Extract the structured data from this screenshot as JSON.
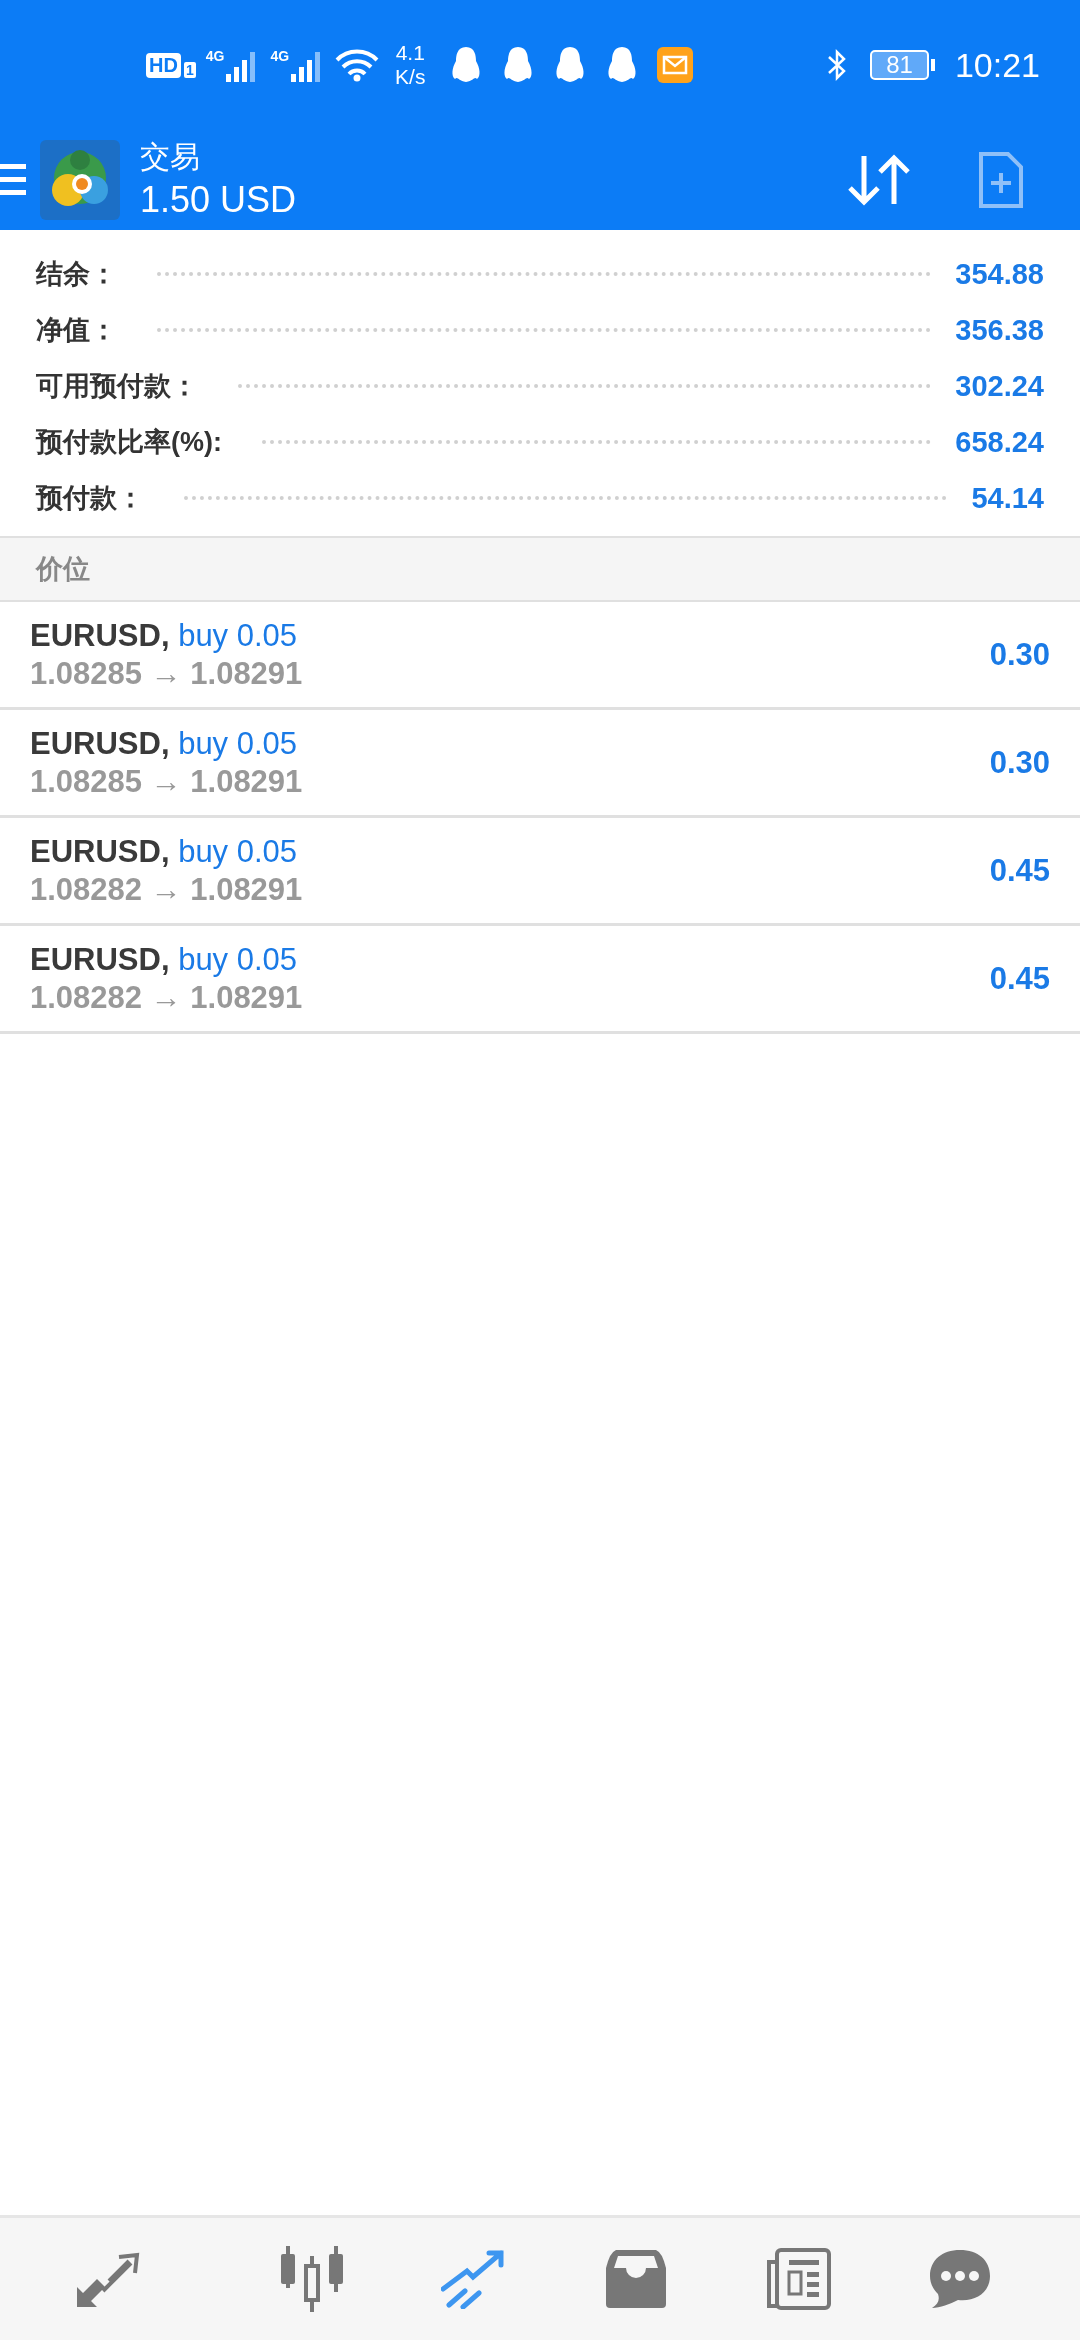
{
  "status_bar": {
    "hd": "HD",
    "hd_sub": "1",
    "signals": [
      {
        "label": "4G"
      },
      {
        "label": "4G"
      }
    ],
    "speed": "4.1",
    "speed_unit": "K/s",
    "notifications": [
      {
        "kind": "penguin"
      },
      {
        "kind": "penguin"
      },
      {
        "kind": "penguin"
      },
      {
        "kind": "penguin"
      },
      {
        "kind": "mail"
      }
    ],
    "battery": "81",
    "time": "10:21"
  },
  "header": {
    "title": "交易",
    "subtitle": "1.50 USD"
  },
  "summary": [
    {
      "label": "结余：",
      "value": "354.88"
    },
    {
      "label": "净值：",
      "value": "356.38"
    },
    {
      "label": "可用预付款：",
      "value": "302.24"
    },
    {
      "label": "预付款比率(%):",
      "value": "658.24"
    },
    {
      "label": "预付款：",
      "value": "54.14"
    }
  ],
  "section": "价位",
  "positions": [
    {
      "symbol": "EURUSD,",
      "side": "buy 0.05",
      "prices": "1.08285 → 1.08291",
      "profit": "0.30"
    },
    {
      "symbol": "EURUSD,",
      "side": "buy 0.05",
      "prices": "1.08285 → 1.08291",
      "profit": "0.30"
    },
    {
      "symbol": "EURUSD,",
      "side": "buy 0.05",
      "prices": "1.08282 → 1.08291",
      "profit": "0.45"
    },
    {
      "symbol": "EURUSD,",
      "side": "buy 0.05",
      "prices": "1.08282 → 1.08291",
      "profit": "0.45"
    }
  ],
  "nav": [
    {
      "kind": "trade",
      "selected": false
    },
    {
      "kind": "chart",
      "selected": false
    },
    {
      "kind": "trading",
      "selected": true
    },
    {
      "kind": "history",
      "selected": false
    },
    {
      "kind": "news",
      "selected": false
    },
    {
      "kind": "chat",
      "selected": false
    }
  ]
}
